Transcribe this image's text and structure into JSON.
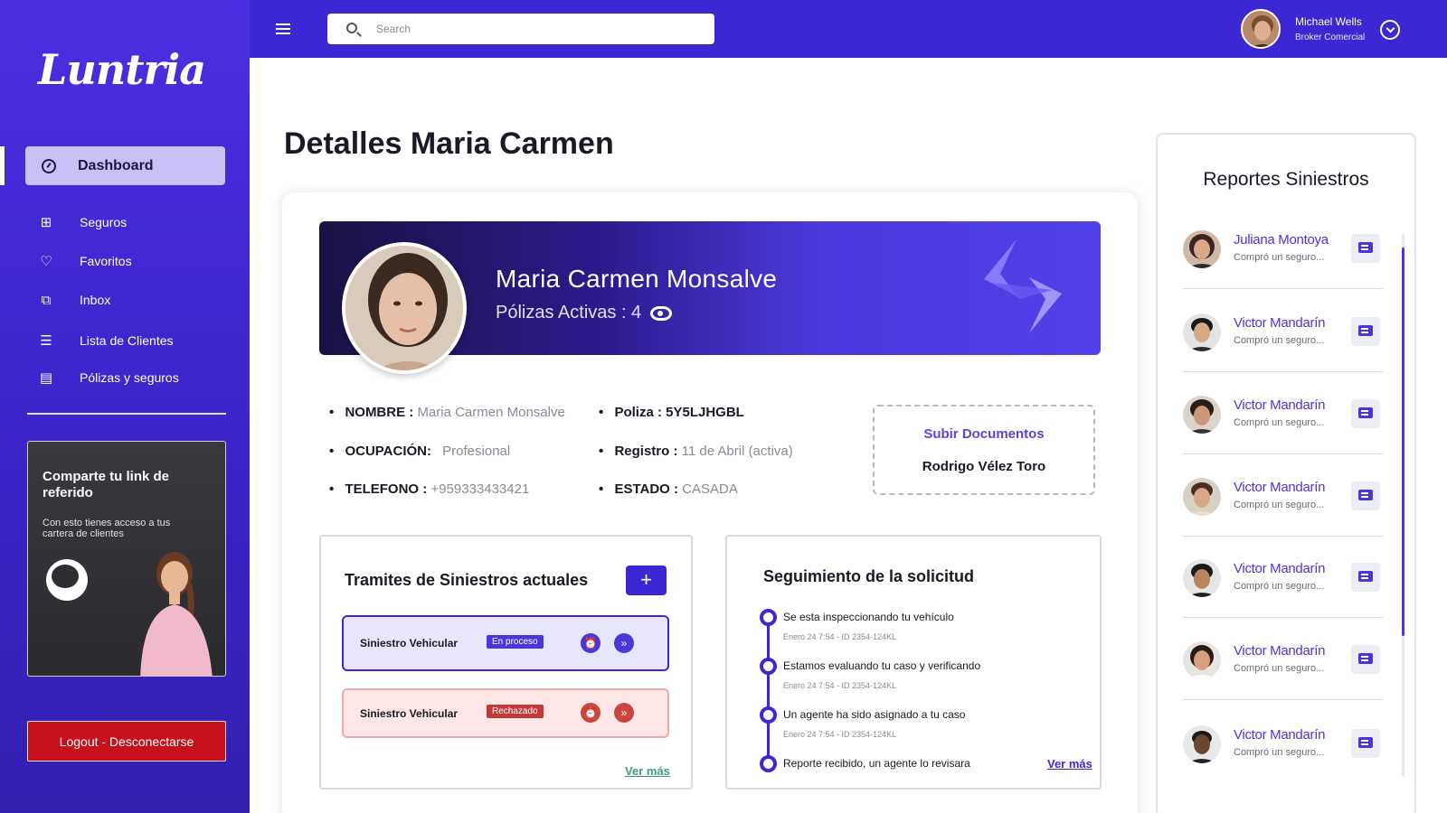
{
  "app": {
    "logo": "Luntria"
  },
  "sidebar": {
    "active": {
      "label": "Dashboard"
    },
    "items": [
      {
        "label": "Seguros",
        "icon": "grid-icon"
      },
      {
        "label": "Favoritos",
        "icon": "heart-icon"
      },
      {
        "label": "Inbox",
        "icon": "inbox-icon"
      },
      {
        "label": "Lista de Clientes",
        "icon": "list-icon"
      },
      {
        "label": "Pólizas y seguros",
        "icon": "document-icon"
      }
    ],
    "promo": {
      "title": "Comparte  tu link de referido",
      "text": "Con esto tienes acceso a tus cartera de clientes"
    },
    "logout": "Logout - Desconectarse"
  },
  "header": {
    "search_placeholder": "Search",
    "user": {
      "name": "Michael Wells",
      "role": "Broker Comercial"
    }
  },
  "page": {
    "title": "Detalles Maria Carmen"
  },
  "banner": {
    "name": "Maria Carmen Monsalve",
    "polizas": "Pólizas Activas : 4"
  },
  "info": {
    "nombre_label": "NOMBRE :",
    "nombre": "Maria Carmen Monsalve",
    "ocupacion_label": "OCUPACIÓN:",
    "ocupacion": "Profesional",
    "telefono_label": "TELEFONO :",
    "telefono": "+959333433421",
    "poliza_label": "Poliza :",
    "poliza": "5Y5LJHGBL",
    "registro_label": "Registro :",
    "registro": "11 de Abril (activa)",
    "estado_label": "ESTADO :",
    "estado": "CASADA"
  },
  "upload": {
    "label": "Subir Documentos",
    "person": "Rodrigo Vélez Toro"
  },
  "tramites": {
    "title": "Tramites de Siniestros actuales",
    "add": "+",
    "rows": [
      {
        "title": "Siniestro Vehicular",
        "status": "En proceso"
      },
      {
        "title": "Siniestro Vehicular",
        "status": "Rechazado"
      }
    ],
    "more": "Ver más"
  },
  "seguimiento": {
    "title": "Seguimiento de la solicitud",
    "steps": [
      {
        "text": "Se esta inspeccionando tu vehículo",
        "meta": "Enero 24 7:54 - ID 2354-124KL"
      },
      {
        "text": "Estamos evaluando tu caso y verificando",
        "meta": "Enero 24 7:54 - ID 2354-124KL"
      },
      {
        "text": "Un agente ha sido asignado a tu caso",
        "meta": "Enero 24 7:54 - ID 2354-124KL"
      },
      {
        "text": "Reporte recibido, un agente lo revisara",
        "meta": ""
      }
    ],
    "more": "Ver más"
  },
  "reports": {
    "title": "Reportes Siniestros",
    "items": [
      {
        "name": "Juliana Montoya",
        "desc": "Compró un seguro..."
      },
      {
        "name": "Victor Mandarín",
        "desc": "Compró un seguro..."
      },
      {
        "name": "Victor Mandarín",
        "desc": "Compró un seguro..."
      },
      {
        "name": "Victor Mandarín",
        "desc": "Compró un seguro..."
      },
      {
        "name": "Victor Mandarín",
        "desc": "Compró un seguro..."
      },
      {
        "name": "Victor Mandarín",
        "desc": "Compró un seguro..."
      },
      {
        "name": "Victor Mandarín",
        "desc": "Compró un seguro..."
      }
    ]
  },
  "colors": {
    "primary": "#3c27d4",
    "danger": "#c6101c",
    "accent_green": "#3a9e78"
  }
}
